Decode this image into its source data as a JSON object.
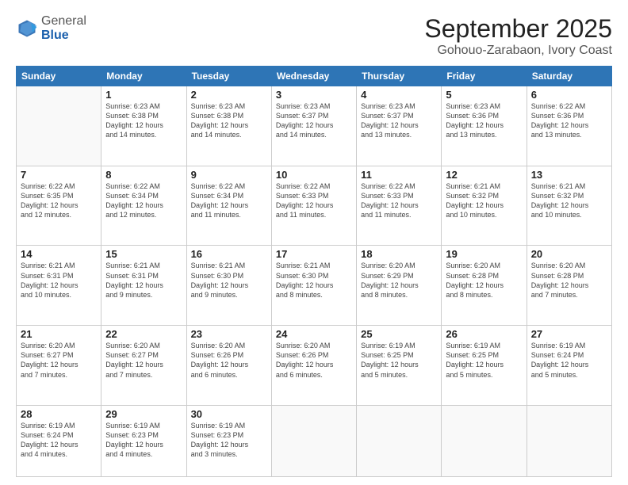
{
  "header": {
    "logo_general": "General",
    "logo_blue": "Blue",
    "month": "September 2025",
    "location": "Gohouo-Zarabaon, Ivory Coast"
  },
  "weekdays": [
    "Sunday",
    "Monday",
    "Tuesday",
    "Wednesday",
    "Thursday",
    "Friday",
    "Saturday"
  ],
  "weeks": [
    [
      {
        "day": "",
        "info": ""
      },
      {
        "day": "1",
        "info": "Sunrise: 6:23 AM\nSunset: 6:38 PM\nDaylight: 12 hours\nand 14 minutes."
      },
      {
        "day": "2",
        "info": "Sunrise: 6:23 AM\nSunset: 6:38 PM\nDaylight: 12 hours\nand 14 minutes."
      },
      {
        "day": "3",
        "info": "Sunrise: 6:23 AM\nSunset: 6:37 PM\nDaylight: 12 hours\nand 14 minutes."
      },
      {
        "day": "4",
        "info": "Sunrise: 6:23 AM\nSunset: 6:37 PM\nDaylight: 12 hours\nand 13 minutes."
      },
      {
        "day": "5",
        "info": "Sunrise: 6:23 AM\nSunset: 6:36 PM\nDaylight: 12 hours\nand 13 minutes."
      },
      {
        "day": "6",
        "info": "Sunrise: 6:22 AM\nSunset: 6:36 PM\nDaylight: 12 hours\nand 13 minutes."
      }
    ],
    [
      {
        "day": "7",
        "info": "Sunrise: 6:22 AM\nSunset: 6:35 PM\nDaylight: 12 hours\nand 12 minutes."
      },
      {
        "day": "8",
        "info": "Sunrise: 6:22 AM\nSunset: 6:34 PM\nDaylight: 12 hours\nand 12 minutes."
      },
      {
        "day": "9",
        "info": "Sunrise: 6:22 AM\nSunset: 6:34 PM\nDaylight: 12 hours\nand 11 minutes."
      },
      {
        "day": "10",
        "info": "Sunrise: 6:22 AM\nSunset: 6:33 PM\nDaylight: 12 hours\nand 11 minutes."
      },
      {
        "day": "11",
        "info": "Sunrise: 6:22 AM\nSunset: 6:33 PM\nDaylight: 12 hours\nand 11 minutes."
      },
      {
        "day": "12",
        "info": "Sunrise: 6:21 AM\nSunset: 6:32 PM\nDaylight: 12 hours\nand 10 minutes."
      },
      {
        "day": "13",
        "info": "Sunrise: 6:21 AM\nSunset: 6:32 PM\nDaylight: 12 hours\nand 10 minutes."
      }
    ],
    [
      {
        "day": "14",
        "info": "Sunrise: 6:21 AM\nSunset: 6:31 PM\nDaylight: 12 hours\nand 10 minutes."
      },
      {
        "day": "15",
        "info": "Sunrise: 6:21 AM\nSunset: 6:31 PM\nDaylight: 12 hours\nand 9 minutes."
      },
      {
        "day": "16",
        "info": "Sunrise: 6:21 AM\nSunset: 6:30 PM\nDaylight: 12 hours\nand 9 minutes."
      },
      {
        "day": "17",
        "info": "Sunrise: 6:21 AM\nSunset: 6:30 PM\nDaylight: 12 hours\nand 8 minutes."
      },
      {
        "day": "18",
        "info": "Sunrise: 6:20 AM\nSunset: 6:29 PM\nDaylight: 12 hours\nand 8 minutes."
      },
      {
        "day": "19",
        "info": "Sunrise: 6:20 AM\nSunset: 6:28 PM\nDaylight: 12 hours\nand 8 minutes."
      },
      {
        "day": "20",
        "info": "Sunrise: 6:20 AM\nSunset: 6:28 PM\nDaylight: 12 hours\nand 7 minutes."
      }
    ],
    [
      {
        "day": "21",
        "info": "Sunrise: 6:20 AM\nSunset: 6:27 PM\nDaylight: 12 hours\nand 7 minutes."
      },
      {
        "day": "22",
        "info": "Sunrise: 6:20 AM\nSunset: 6:27 PM\nDaylight: 12 hours\nand 7 minutes."
      },
      {
        "day": "23",
        "info": "Sunrise: 6:20 AM\nSunset: 6:26 PM\nDaylight: 12 hours\nand 6 minutes."
      },
      {
        "day": "24",
        "info": "Sunrise: 6:20 AM\nSunset: 6:26 PM\nDaylight: 12 hours\nand 6 minutes."
      },
      {
        "day": "25",
        "info": "Sunrise: 6:19 AM\nSunset: 6:25 PM\nDaylight: 12 hours\nand 5 minutes."
      },
      {
        "day": "26",
        "info": "Sunrise: 6:19 AM\nSunset: 6:25 PM\nDaylight: 12 hours\nand 5 minutes."
      },
      {
        "day": "27",
        "info": "Sunrise: 6:19 AM\nSunset: 6:24 PM\nDaylight: 12 hours\nand 5 minutes."
      }
    ],
    [
      {
        "day": "28",
        "info": "Sunrise: 6:19 AM\nSunset: 6:24 PM\nDaylight: 12 hours\nand 4 minutes."
      },
      {
        "day": "29",
        "info": "Sunrise: 6:19 AM\nSunset: 6:23 PM\nDaylight: 12 hours\nand 4 minutes."
      },
      {
        "day": "30",
        "info": "Sunrise: 6:19 AM\nSunset: 6:23 PM\nDaylight: 12 hours\nand 3 minutes."
      },
      {
        "day": "",
        "info": ""
      },
      {
        "day": "",
        "info": ""
      },
      {
        "day": "",
        "info": ""
      },
      {
        "day": "",
        "info": ""
      }
    ]
  ]
}
